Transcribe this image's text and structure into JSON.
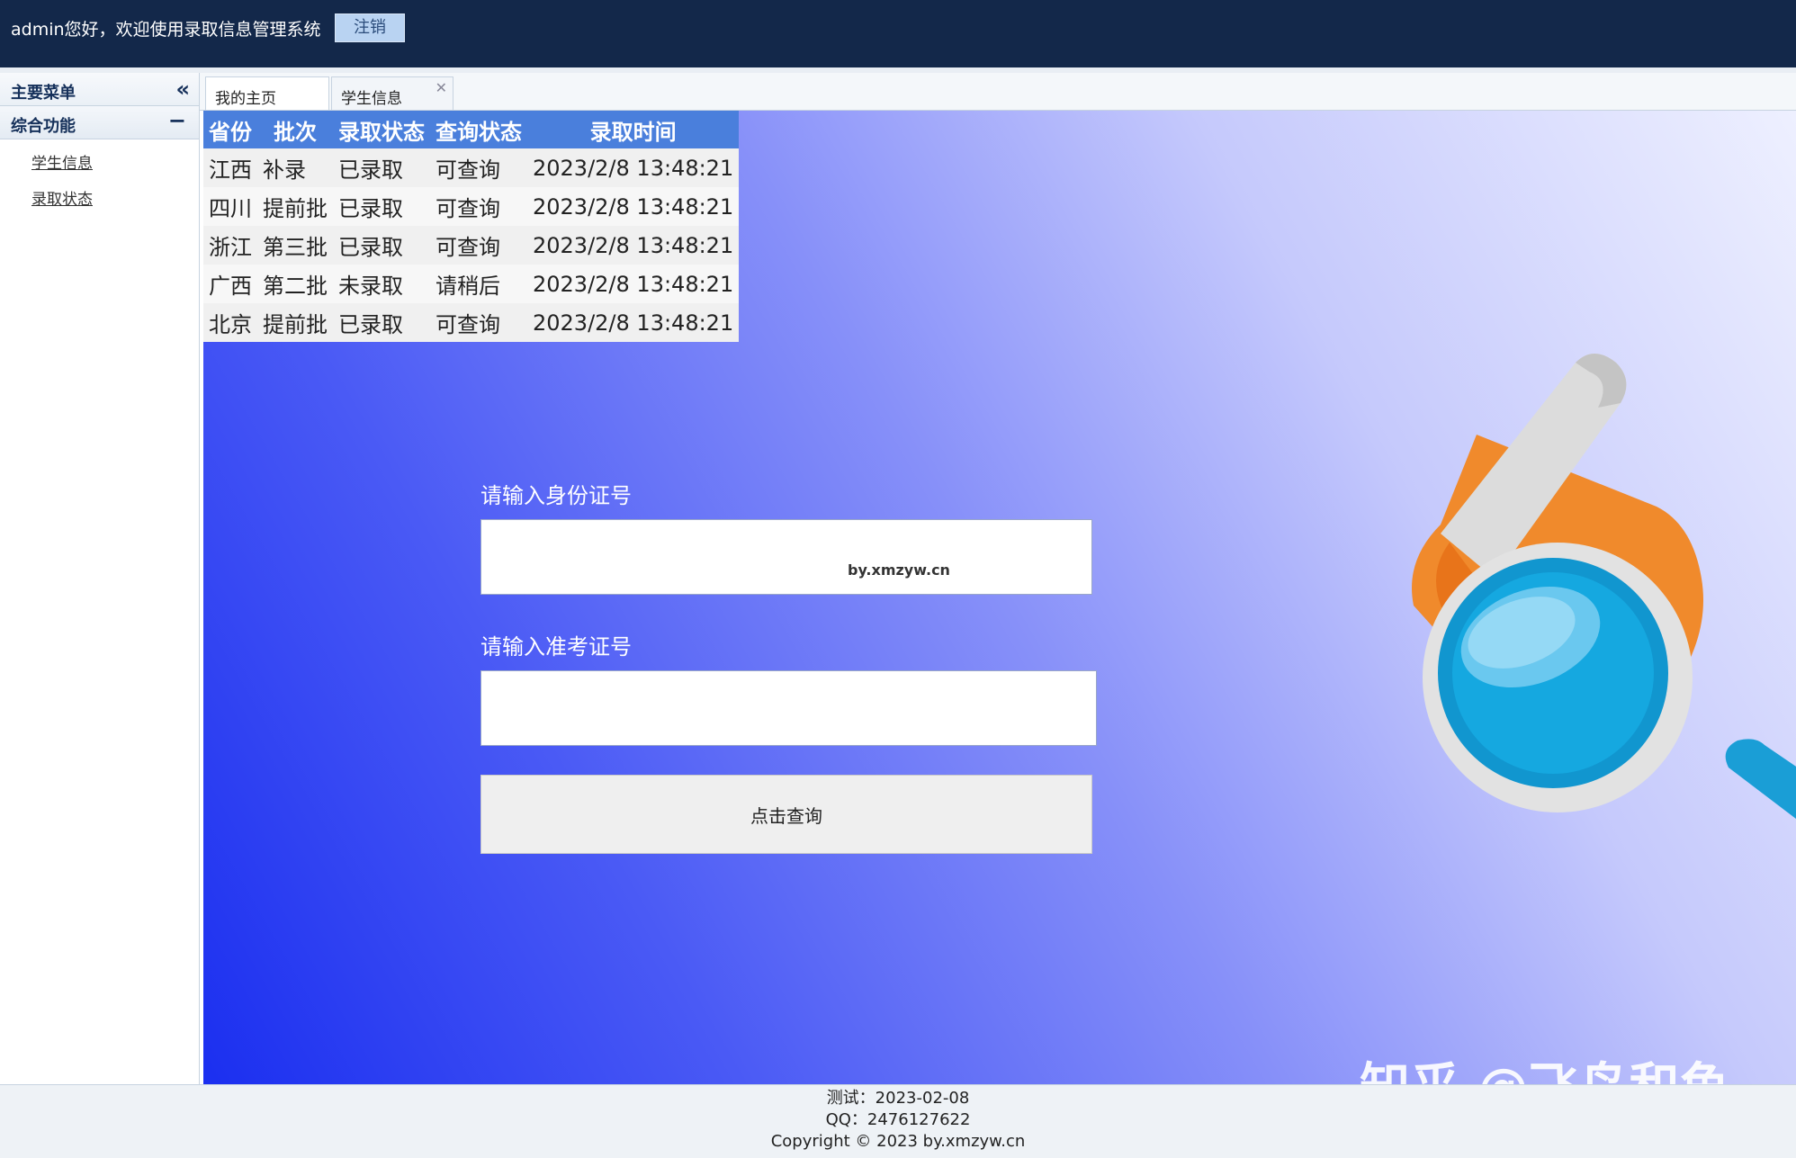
{
  "header": {
    "welcome": "admin您好，欢迎使用录取信息管理系统",
    "logout_label": "注销"
  },
  "sidebar": {
    "title": "主要菜单",
    "collapse_icon": "double-chevron-left-icon",
    "group_title": "综合功能",
    "group_icon": "minus-icon",
    "items": [
      {
        "label": "学生信息"
      },
      {
        "label": "录取状态"
      }
    ]
  },
  "tabs": [
    {
      "label": "我的主页",
      "closable": false
    },
    {
      "label": "学生信息",
      "closable": true,
      "close_icon": "close-icon"
    }
  ],
  "admission_table": {
    "headers": [
      "省份",
      "批次",
      "录取状态",
      "查询状态",
      "录取时间"
    ],
    "rows": [
      [
        "江西",
        "补录",
        "已录取",
        "可查询",
        "2023/2/8 13:48:21"
      ],
      [
        "四川",
        "提前批",
        "已录取",
        "可查询",
        "2023/2/8 13:48:21"
      ],
      [
        "浙江",
        "第三批",
        "已录取",
        "可查询",
        "2023/2/8 13:48:21"
      ],
      [
        "广西",
        "第二批",
        "未录取",
        "请稍后",
        "2023/2/8 13:48:21"
      ],
      [
        "北京",
        "提前批",
        "已录取",
        "可查询",
        "2023/2/8 13:48:21"
      ]
    ]
  },
  "form": {
    "id_label": "请输入身份证号",
    "id_value": "",
    "watermark": "by.xmzyw.cn",
    "exam_label": "请输入准考证号",
    "exam_value": "",
    "submit_label": "点击查询"
  },
  "illustration": "magnifier-map-icon",
  "watermark_text": "知乎 @飞鸟和鱼",
  "colors": {
    "header_bg": "#13284a",
    "table_header_bg": "#4a7fdc",
    "gradient_start": "#1b2ff0",
    "gradient_end": "#eef0ff"
  },
  "footer": {
    "line1": "测试：2023-02-08",
    "line2": "QQ：2476127622",
    "line3": "Copyright © 2023 by.xmzyw.cn"
  }
}
